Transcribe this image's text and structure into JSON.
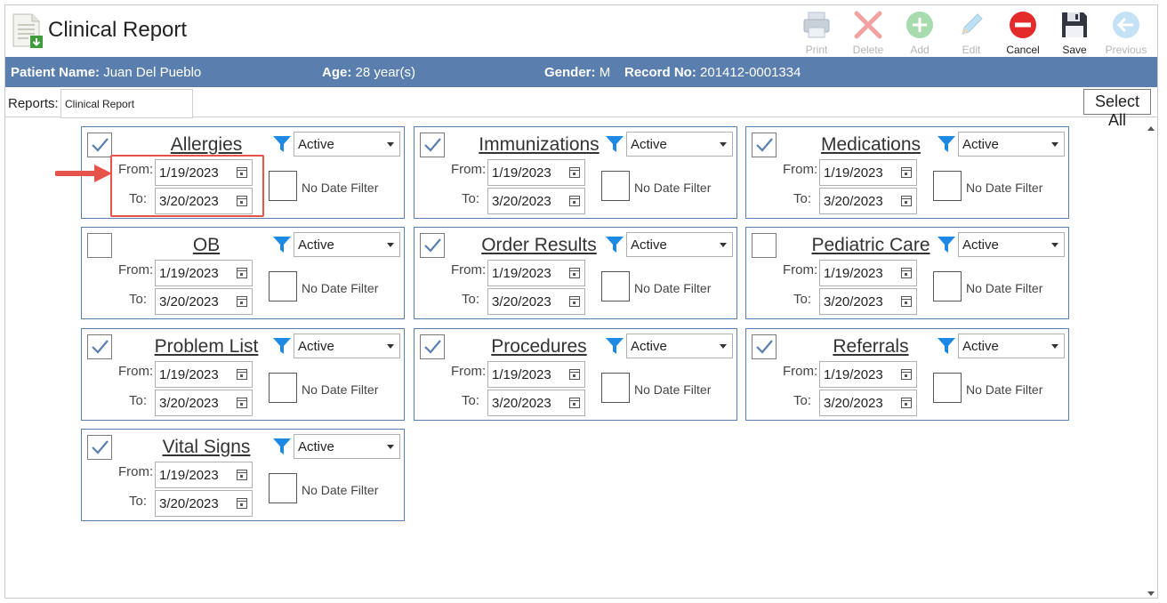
{
  "header": {
    "title": "Clinical Report",
    "toolbar": [
      {
        "label": "Print",
        "icon": "printer-icon",
        "enabled": false
      },
      {
        "label": "Delete",
        "icon": "delete-x-icon",
        "enabled": false
      },
      {
        "label": "Add",
        "icon": "add-plus-icon",
        "enabled": false
      },
      {
        "label": "Edit",
        "icon": "pencil-icon",
        "enabled": false
      },
      {
        "label": "Cancel",
        "icon": "cancel-minus-icon",
        "enabled": true
      },
      {
        "label": "Save",
        "icon": "floppy-disk-icon",
        "enabled": true
      },
      {
        "label": "Previous",
        "icon": "back-arrow-icon",
        "enabled": false
      }
    ]
  },
  "patient": {
    "name_label": "Patient Name:",
    "name": "Juan Del Pueblo",
    "age_label": "Age:",
    "age": "28 year(s)",
    "gender_label": "Gender:",
    "gender": "M",
    "record_label": "Record No:",
    "record": "201412-0001334"
  },
  "reports": {
    "label": "Reports:",
    "value": "Clinical Report",
    "select_all": "Select All"
  },
  "labels": {
    "from": "From:",
    "to": "To:",
    "no_date_filter": "No Date Filter"
  },
  "panels": [
    {
      "title": "Allergies",
      "checked": true,
      "status": "Active",
      "from": "1/19/2023",
      "to": "3/20/2023"
    },
    {
      "title": "Immunizations",
      "checked": true,
      "status": "Active",
      "from": "1/19/2023",
      "to": "3/20/2023"
    },
    {
      "title": "Medications",
      "checked": true,
      "status": "Active",
      "from": "1/19/2023",
      "to": "3/20/2023"
    },
    {
      "title": "OB",
      "checked": false,
      "status": "Active",
      "from": "1/19/2023",
      "to": "3/20/2023"
    },
    {
      "title": "Order Results",
      "checked": true,
      "status": "Active",
      "from": "1/19/2023",
      "to": "3/20/2023"
    },
    {
      "title": "Pediatric Care",
      "checked": false,
      "status": "Active",
      "from": "1/19/2023",
      "to": "3/20/2023"
    },
    {
      "title": "Problem List",
      "checked": true,
      "status": "Active",
      "from": "1/19/2023",
      "to": "3/20/2023"
    },
    {
      "title": "Procedures",
      "checked": true,
      "status": "Active",
      "from": "1/19/2023",
      "to": "3/20/2023"
    },
    {
      "title": "Referrals",
      "checked": true,
      "status": "Active",
      "from": "1/19/2023",
      "to": "3/20/2023"
    },
    {
      "title": "Vital Signs",
      "checked": true,
      "status": "Active",
      "from": "1/19/2023",
      "to": "3/20/2023"
    }
  ],
  "colors": {
    "patient_bar": "#5a7fae",
    "panel_border": "#5a7fae",
    "filter_icon": "#1e88e5",
    "highlight": "#e5534b"
  }
}
